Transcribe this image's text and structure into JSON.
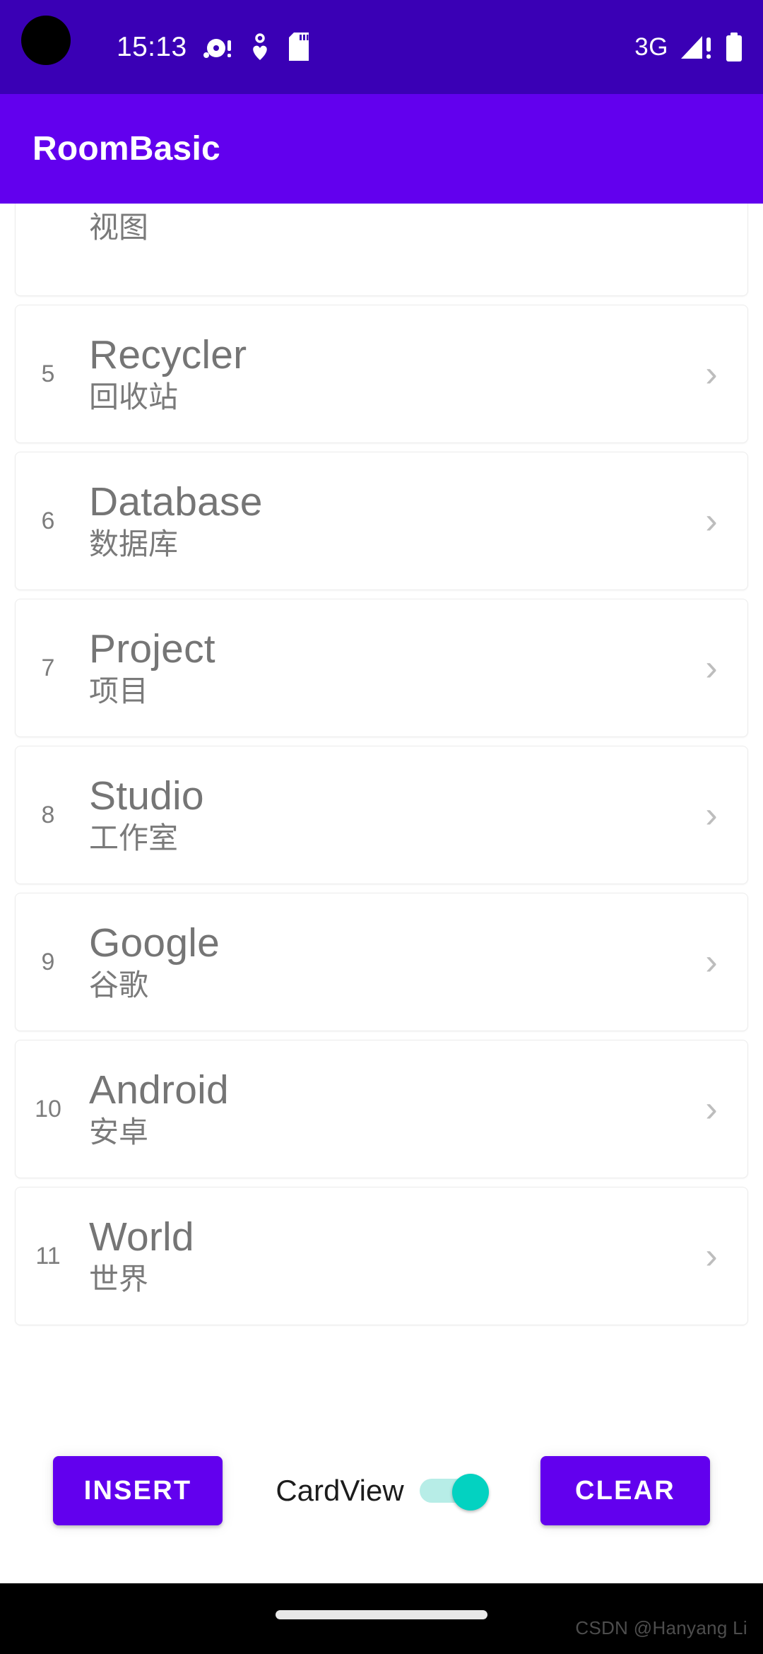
{
  "status_bar": {
    "time": "15:13",
    "network_type": "3G",
    "icons_left": [
      "disc-alert-icon",
      "heart-location-icon",
      "sd-card-icon"
    ],
    "icons_right": [
      "signal-bars-alert-icon",
      "battery-full-icon"
    ],
    "background_color": "#3A00B5"
  },
  "app_bar": {
    "title": "RoomBasic",
    "background_color": "#6200EE",
    "text_color": "#FFFFFF"
  },
  "list": {
    "partial_top_item": {
      "subtitle": "视图"
    },
    "items": [
      {
        "index": "5",
        "title": "Recycler",
        "subtitle": "回收站",
        "chevron": "›"
      },
      {
        "index": "6",
        "title": "Database",
        "subtitle": "数据库",
        "chevron": "›"
      },
      {
        "index": "7",
        "title": "Project",
        "subtitle": "项目",
        "chevron": "›"
      },
      {
        "index": "8",
        "title": "Studio",
        "subtitle": "工作室",
        "chevron": "›"
      },
      {
        "index": "9",
        "title": "Google",
        "subtitle": "谷歌",
        "chevron": "›"
      },
      {
        "index": "10",
        "title": "Android",
        "subtitle": "安卓",
        "chevron": "›"
      },
      {
        "index": "11",
        "title": "World",
        "subtitle": "世界",
        "chevron": "›"
      }
    ]
  },
  "bottom_bar": {
    "insert_label": "INSERT",
    "clear_label": "CLEAR",
    "switch_label": "CardView",
    "switch_state": "on",
    "button_color": "#6200EE",
    "switch_thumb_color": "#03D2C1",
    "switch_track_color": "#B7EDE7"
  },
  "nav_bar": {
    "watermark": "CSDN @Hanyang Li"
  }
}
